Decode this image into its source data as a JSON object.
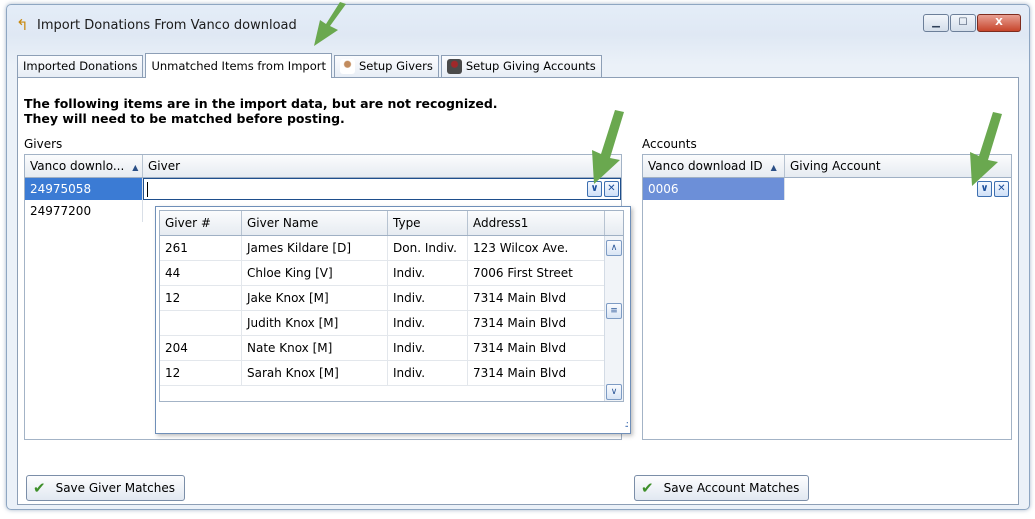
{
  "window": {
    "title": "Import Donations From Vanco download",
    "controls": {
      "minimize": "▁",
      "maximize": "☐",
      "close": "X"
    }
  },
  "tabs": [
    {
      "label": "Imported Donations"
    },
    {
      "label": "Unmatched Items from Import",
      "active": true
    },
    {
      "label": "Setup Givers",
      "icon": "person-icon"
    },
    {
      "label": "Setup Giving Accounts",
      "icon": "account-icon"
    }
  ],
  "main": {
    "heading_line1": "The following items are in the import data, but are not recognized.",
    "heading_line2": "They will need to be matched before posting."
  },
  "givers": {
    "section_label": "Givers",
    "columns": [
      "Vanco downlo...",
      "Giver"
    ],
    "rows": [
      {
        "id": "24975058",
        "giver": ""
      },
      {
        "id": "24977200",
        "giver": ""
      }
    ],
    "save_label": "Save Giver Matches"
  },
  "giver_dropdown": {
    "columns": [
      "Giver #",
      "Giver Name",
      "Type",
      "Address1"
    ],
    "rows": [
      {
        "num": "261",
        "name": "James Kildare [D]",
        "type": "Don. Indiv.",
        "address": "123 Wilcox Ave."
      },
      {
        "num": "44",
        "name": "Chloe King [V]",
        "type": "Indiv.",
        "address": "7006 First Street"
      },
      {
        "num": "12",
        "name": "Jake Knox [M]",
        "type": "Indiv.",
        "address": "7314 Main Blvd"
      },
      {
        "num": "",
        "name": "Judith Knox [M]",
        "type": "Indiv.",
        "address": "7314 Main Blvd"
      },
      {
        "num": "204",
        "name": "Nate Knox [M]",
        "type": "Indiv.",
        "address": "7314 Main Blvd"
      },
      {
        "num": "12",
        "name": "Sarah Knox [M]",
        "type": "Indiv.",
        "address": "7314 Main Blvd"
      }
    ]
  },
  "accounts": {
    "section_label": "Accounts",
    "columns": [
      "Vanco download ID",
      "Giving Account"
    ],
    "rows": [
      {
        "id": "0006",
        "account": ""
      }
    ],
    "save_label": "Save Account Matches"
  },
  "colors": {
    "accent_arrow": "#6aa84f",
    "selection": "#3b7bd4",
    "save_check": "#3e8f2a"
  }
}
